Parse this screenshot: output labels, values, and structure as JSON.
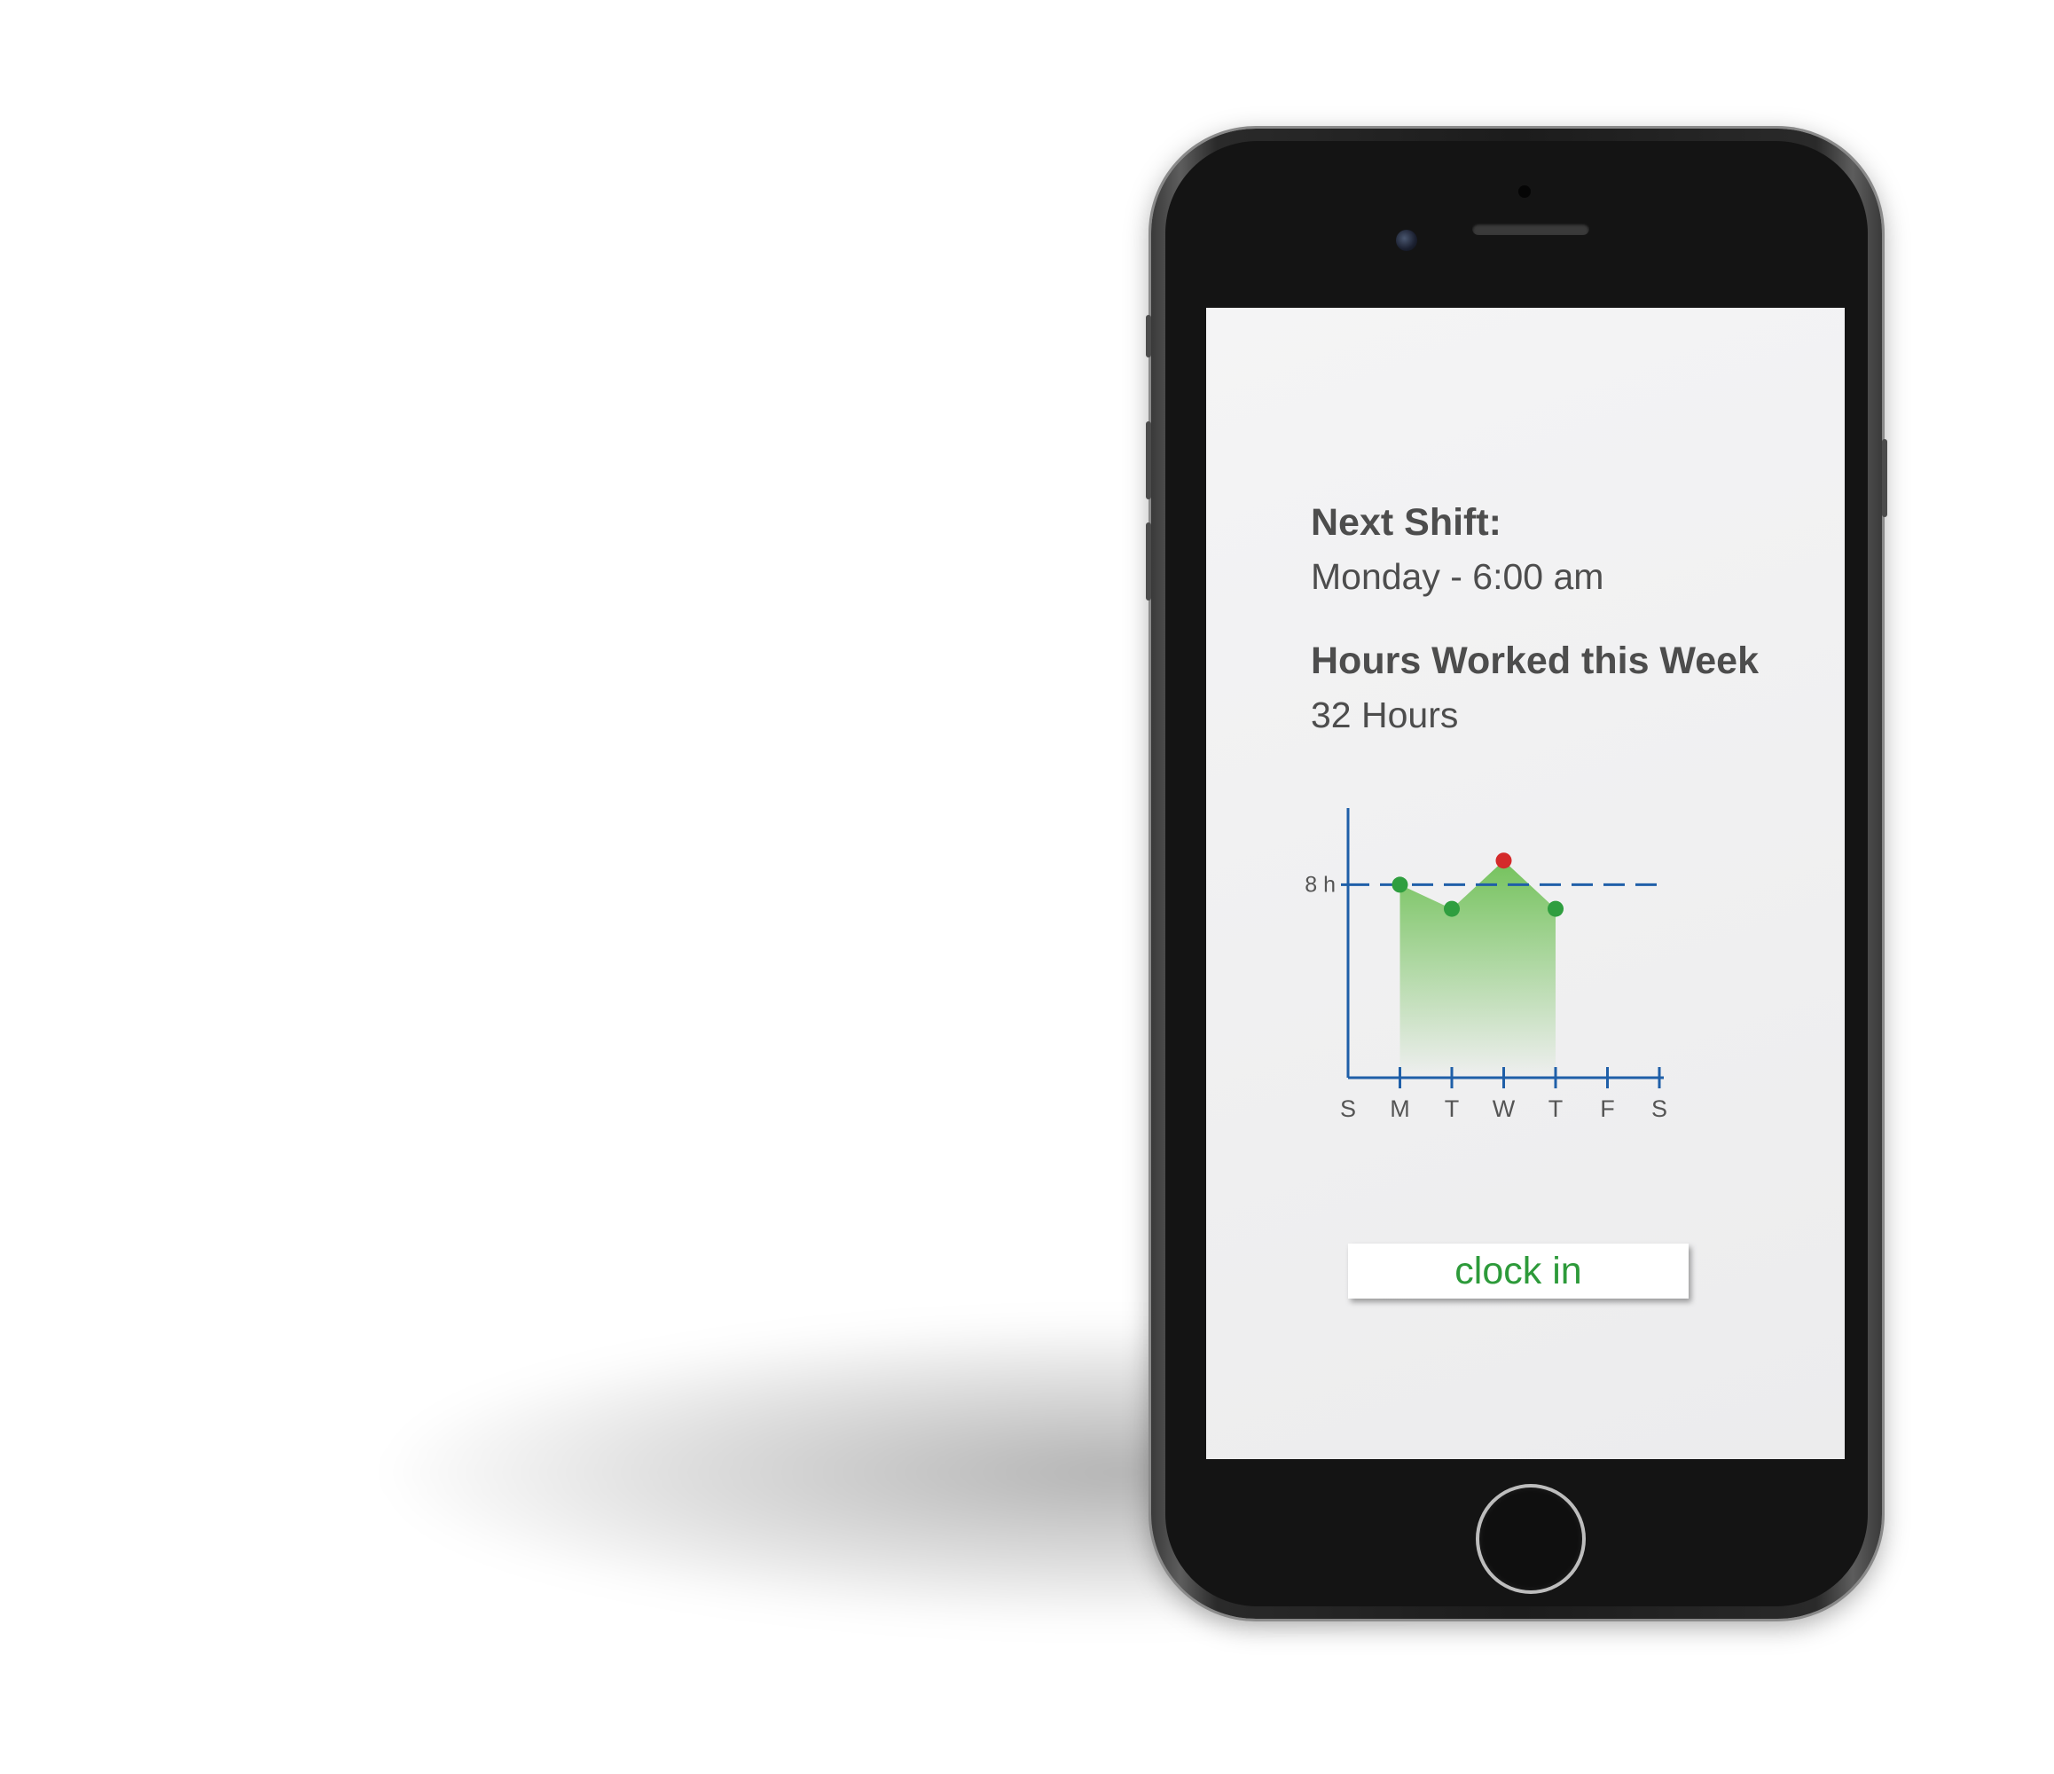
{
  "shift": {
    "title": "Next Shift:",
    "value": "Monday - 6:00 am"
  },
  "hours": {
    "title": "Hours Worked this Week",
    "value": "32 Hours"
  },
  "chart_data": {
    "type": "area",
    "categories": [
      "S",
      "M",
      "T",
      "W",
      "T",
      "F",
      "S"
    ],
    "values": [
      null,
      8,
      7,
      9,
      7,
      null,
      null
    ],
    "reference_line": {
      "label": "8 h",
      "value": 8
    },
    "over_target_color": "#d42a2a",
    "point_color": "#2f9e3f",
    "axis_color": "#1f5fa8",
    "fill_color": "#74c25c"
  },
  "clock_button": {
    "label": "clock in",
    "color": "#2d9a3a"
  }
}
